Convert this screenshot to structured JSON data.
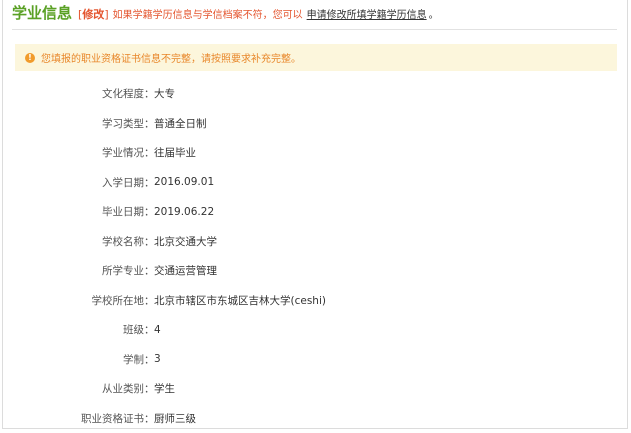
{
  "header": {
    "title": "学业信息",
    "bracket_open": "[",
    "edit_label": "修改",
    "bracket_close": "]",
    "notice": "如果学籍学历信息与学信档案不符，您可以",
    "apply_link": "申请修改所填学籍学历信息",
    "period": "。"
  },
  "warning": {
    "icon": "!",
    "text": "您填报的职业资格证书信息不完整，请按照要求补充完整。"
  },
  "colon": "：",
  "fields": [
    {
      "label": "文化程度",
      "value": "大专"
    },
    {
      "label": "学习类型",
      "value": "普通全日制"
    },
    {
      "label": "学业情况",
      "value": "往届毕业"
    },
    {
      "label": "入学日期",
      "value": "2016.09.01"
    },
    {
      "label": "毕业日期",
      "value": "2019.06.22"
    },
    {
      "label": "学校名称",
      "value": "北京交通大学"
    },
    {
      "label": "所学专业",
      "value": "交通运营管理"
    },
    {
      "label": "学校所在地",
      "value": "北京市辖区市东城区吉林大学(ceshi)"
    },
    {
      "label": "班级",
      "value": "4"
    },
    {
      "label": "学制",
      "value": "3"
    },
    {
      "label": "从业类别",
      "value": "学生"
    },
    {
      "label": "职业资格证书",
      "value": "厨师三级"
    }
  ]
}
